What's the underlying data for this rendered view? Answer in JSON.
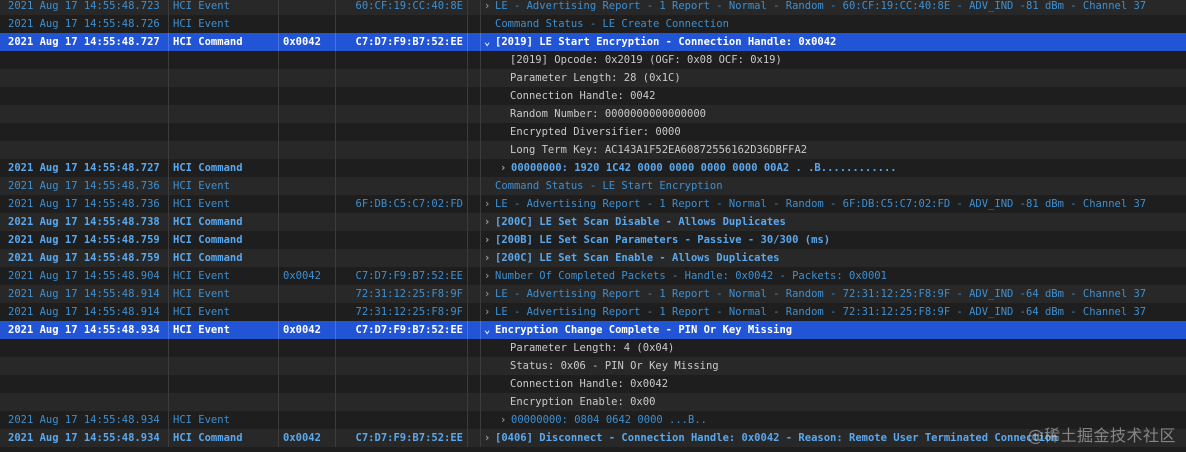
{
  "rows": [
    {
      "ts": "2021 Aug 17 14:55:48.723",
      "type": "HCI Event",
      "handle": "",
      "addr": "60:CF:19:CC:40:8E",
      "chev": "›",
      "summary": "LE - Advertising Report - 1 Report - Normal - Random - 60:CF:19:CC:40:8E - ADV_IND  -81 dBm - Channel 37",
      "kind": "event"
    },
    {
      "ts": "2021 Aug 17 14:55:48.726",
      "type": "HCI Event",
      "handle": "",
      "addr": "",
      "chev": "",
      "summary": "Command Status - LE Create Connection",
      "kind": "event"
    },
    {
      "ts": "2021 Aug 17 14:55:48.727",
      "type": "HCI Command",
      "handle": "0x0042",
      "addr": "C7:D7:F9:B7:52:EE",
      "chev": "⌄",
      "summary": "[2019] LE Start Encryption - Connection Handle: 0x0042",
      "kind": "selected"
    },
    {
      "ts": "",
      "type": "",
      "handle": "",
      "addr": "",
      "chev": "",
      "summary": "[2019] Opcode: 0x2019 (OGF: 0x08    OCF: 0x19)",
      "kind": "detail"
    },
    {
      "ts": "",
      "type": "",
      "handle": "",
      "addr": "",
      "chev": "",
      "summary": "Parameter Length: 28 (0x1C)",
      "kind": "detail"
    },
    {
      "ts": "",
      "type": "",
      "handle": "",
      "addr": "",
      "chev": "",
      "summary": "Connection Handle: 0042",
      "kind": "detail"
    },
    {
      "ts": "",
      "type": "",
      "handle": "",
      "addr": "",
      "chev": "",
      "summary": "Random Number: 0000000000000000",
      "kind": "detail"
    },
    {
      "ts": "",
      "type": "",
      "handle": "",
      "addr": "",
      "chev": "",
      "summary": "Encrypted Diversifier: 0000",
      "kind": "detail"
    },
    {
      "ts": "",
      "type": "",
      "handle": "",
      "addr": "",
      "chev": "",
      "summary": "Long Term Key: AC143A1F52EA60872556162D36DBFFA2",
      "kind": "detail"
    },
    {
      "ts": "2021 Aug 17 14:55:48.727",
      "type": "HCI Command",
      "handle": "",
      "addr": "",
      "chev": "›",
      "summary": "00000000: 1920 1C42 0000 0000 0000 0000 00A2  . .B............",
      "kind": "hex-cmd"
    },
    {
      "ts": "2021 Aug 17 14:55:48.736",
      "type": "HCI Event",
      "handle": "",
      "addr": "",
      "chev": "",
      "summary": "Command Status - LE Start Encryption",
      "kind": "event"
    },
    {
      "ts": "2021 Aug 17 14:55:48.736",
      "type": "HCI Event",
      "handle": "",
      "addr": "6F:DB:C5:C7:02:FD",
      "chev": "›",
      "summary": "LE - Advertising Report - 1 Report - Normal - Random - 6F:DB:C5:C7:02:FD - ADV_IND  -81 dBm - Channel 37",
      "kind": "event"
    },
    {
      "ts": "2021 Aug 17 14:55:48.738",
      "type": "HCI Command",
      "handle": "",
      "addr": "",
      "chev": "›",
      "summary": "[200C] LE Set Scan Disable - Allows Duplicates",
      "kind": "command"
    },
    {
      "ts": "2021 Aug 17 14:55:48.759",
      "type": "HCI Command",
      "handle": "",
      "addr": "",
      "chev": "›",
      "summary": "[200B] LE Set Scan Parameters - Passive - 30/300 (ms)",
      "kind": "command"
    },
    {
      "ts": "2021 Aug 17 14:55:48.759",
      "type": "HCI Command",
      "handle": "",
      "addr": "",
      "chev": "›",
      "summary": "[200C] LE Set Scan Enable - Allows Duplicates",
      "kind": "command"
    },
    {
      "ts": "2021 Aug 17 14:55:48.904",
      "type": "HCI Event",
      "handle": "0x0042",
      "addr": "C7:D7:F9:B7:52:EE",
      "chev": "›",
      "summary": "Number Of Completed Packets - Handle: 0x0042 - Packets: 0x0001",
      "kind": "event"
    },
    {
      "ts": "2021 Aug 17 14:55:48.914",
      "type": "HCI Event",
      "handle": "",
      "addr": "72:31:12:25:F8:9F",
      "chev": "›",
      "summary": "LE - Advertising Report - 1 Report - Normal - Random - 72:31:12:25:F8:9F - ADV_IND  -64 dBm - Channel 37",
      "kind": "event"
    },
    {
      "ts": "2021 Aug 17 14:55:48.914",
      "type": "HCI Event",
      "handle": "",
      "addr": "72:31:12:25:F8:9F",
      "chev": "›",
      "summary": "LE - Advertising Report - 1 Report - Normal - Random - 72:31:12:25:F8:9F - ADV_IND  -64 dBm - Channel 37",
      "kind": "event"
    },
    {
      "ts": "2021 Aug 17 14:55:48.934",
      "type": "HCI Event",
      "handle": "0x0042",
      "addr": "C7:D7:F9:B7:52:EE",
      "chev": "⌄",
      "summary": "Encryption Change Complete - PIN Or Key Missing",
      "kind": "selected"
    },
    {
      "ts": "",
      "type": "",
      "handle": "",
      "addr": "",
      "chev": "",
      "summary": "Parameter Length: 4 (0x04)",
      "kind": "detail"
    },
    {
      "ts": "",
      "type": "",
      "handle": "",
      "addr": "",
      "chev": "",
      "summary": "Status: 0x06 - PIN Or Key Missing",
      "kind": "detail"
    },
    {
      "ts": "",
      "type": "",
      "handle": "",
      "addr": "",
      "chev": "",
      "summary": "Connection Handle: 0x0042",
      "kind": "detail"
    },
    {
      "ts": "",
      "type": "",
      "handle": "",
      "addr": "",
      "chev": "",
      "summary": "Encryption Enable: 0x00",
      "kind": "detail"
    },
    {
      "ts": "2021 Aug 17 14:55:48.934",
      "type": "HCI Event",
      "handle": "",
      "addr": "",
      "chev": "›",
      "summary": "00000000: 0804 0642 0000                      ...B..",
      "kind": "hex-ev"
    },
    {
      "ts": "2021 Aug 17 14:55:48.934",
      "type": "HCI Command",
      "handle": "0x0042",
      "addr": "C7:D7:F9:B7:52:EE",
      "chev": "›",
      "summary": "[0406] Disconnect - Connection Handle: 0x0042 - Reason: Remote User Terminated Connection",
      "kind": "command"
    }
  ],
  "watermark": "@稀土掘金技术社区",
  "colors": {
    "selection": "#2255d6",
    "event_text": "#3e8fd0",
    "command_text": "#5aa8ee",
    "detail_text": "#c9c9c9"
  }
}
